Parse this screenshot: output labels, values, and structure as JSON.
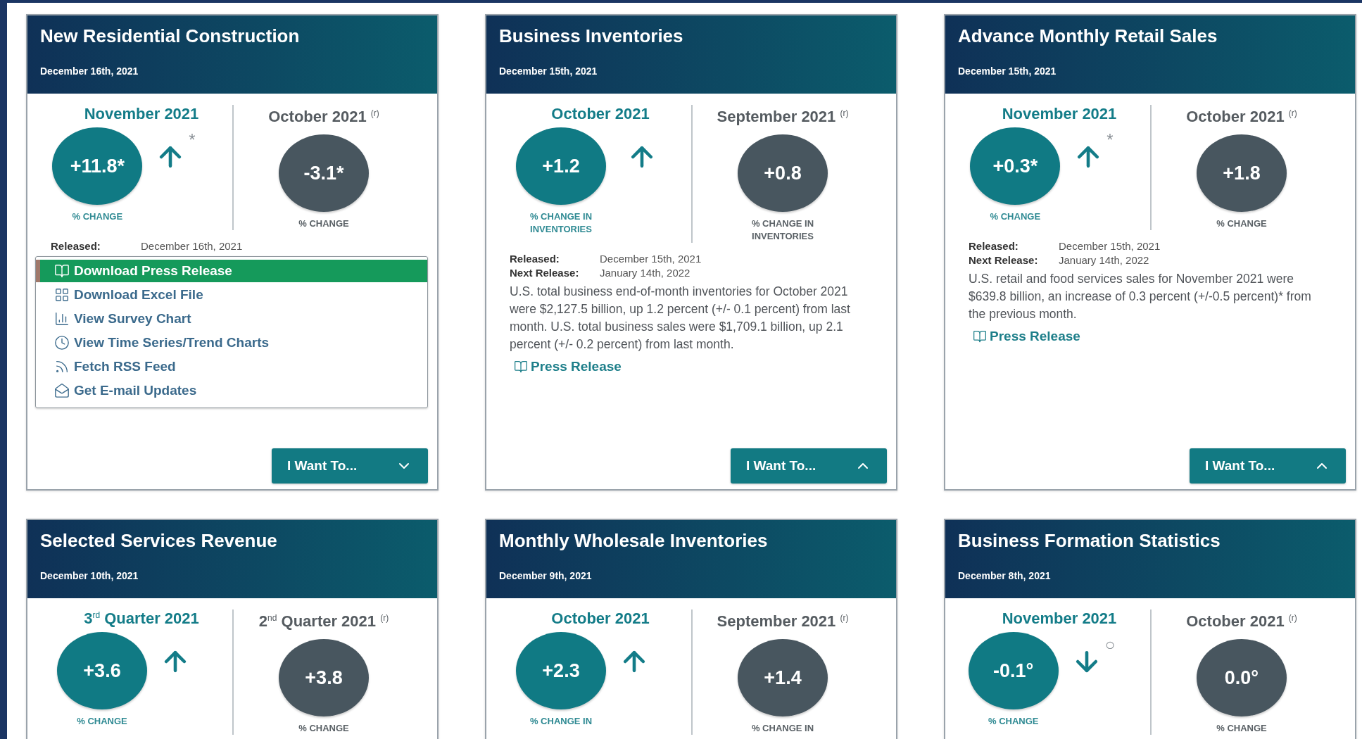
{
  "cards": [
    {
      "title": "New Residential Construction",
      "date": "December 16th, 2021",
      "current": {
        "period": "November 2021",
        "value": "+11.8*",
        "label": "% CHANGE",
        "kind": "up",
        "marker": "*"
      },
      "previous": {
        "period": "October 2021 $^{(r)}$",
        "value": "-3.1*",
        "label": "% CHANGE"
      },
      "released_label": "Released:",
      "released": "December 16th, 2021",
      "menu_open": true,
      "menu": [
        {
          "kind": "book",
          "label": "Download Press Release",
          "selected": true
        },
        {
          "kind": "grid",
          "label": "Download Excel File",
          "selected": false
        },
        {
          "kind": "chart",
          "label": "View Survey Chart",
          "selected": false
        },
        {
          "kind": "clock",
          "label": "View Time Series/Trend Charts",
          "selected": false
        },
        {
          "kind": "rss",
          "label": "Fetch RSS Feed",
          "selected": false
        },
        {
          "kind": "mail",
          "label": "Get E-mail Updates",
          "selected": false
        }
      ],
      "button": "I Want To..."
    },
    {
      "title": "Business Inventories",
      "date": "December 15th, 2021",
      "current": {
        "period": "October 2021",
        "value": "+1.2",
        "label": "% CHANGE IN INVENTORIES",
        "kind": "up"
      },
      "previous": {
        "period": "September 2021 $^{(r)}$",
        "value": "+0.8",
        "label": "% CHANGE IN INVENTORIES"
      },
      "released_label": "Released:",
      "released": "December 15th, 2021",
      "next_label": "Next Release:",
      "next_release": "January 14th, 2022",
      "description": "U.S. total business end-of-month inventories for October 2021 were $2,127.5 billion, up 1.2 percent (+/- 0.1 percent) from last month. U.S. total business sales were $1,709.1 billion, up 2.1 percent (+/- 0.2 percent) from last month.",
      "link": "Press Release",
      "menu_open": false,
      "button": "I Want To..."
    },
    {
      "title": "Advance Monthly Retail Sales",
      "date": "December 15th, 2021",
      "current": {
        "period": "November 2021",
        "value": "+0.3*",
        "label": "% CHANGE",
        "kind": "up",
        "marker": "*"
      },
      "previous": {
        "period": "October 2021 $^{(r)}$",
        "value": "+1.8",
        "label": "% CHANGE"
      },
      "released_label": "Released:",
      "released": "December 15th, 2021",
      "next_label": "Next Release:",
      "next_release": "January 14th, 2022",
      "description": "U.S. retail and food services sales for November 2021 were $639.8 billion, an increase of 0.3 percent (+/-0.5 percent)* from the previous month.",
      "link": "Press Release",
      "menu_open": false,
      "button": "I Want To..."
    },
    {
      "title": "Selected Services Revenue",
      "date": "December 10th, 2021",
      "current": {
        "period": "3$^{rd}$ Quarter 2021",
        "value": "+3.6",
        "label": "% CHANGE",
        "kind": "up"
      },
      "previous": {
        "period": "2$^{nd}$ Quarter 2021 $^{(r)}$",
        "value": "+3.8",
        "label": "% CHANGE"
      }
    },
    {
      "title": "Monthly Wholesale Inventories",
      "date": "December 9th, 2021",
      "current": {
        "period": "October 2021",
        "value": "+2.3",
        "label": "% CHANGE IN",
        "kind": "up"
      },
      "previous": {
        "period": "September 2021 $^{(r)}$",
        "value": "+1.4",
        "label": "% CHANGE IN"
      }
    },
    {
      "title": "Business Formation Statistics",
      "date": "December 8th, 2021",
      "current": {
        "period": "November 2021",
        "value": "-0.1°",
        "label": "% CHANGE",
        "kind": "down",
        "marker": "○"
      },
      "previous": {
        "period": "October 2021 $^{(r)}$",
        "value": "0.0°",
        "label": "% CHANGE"
      }
    }
  ]
}
